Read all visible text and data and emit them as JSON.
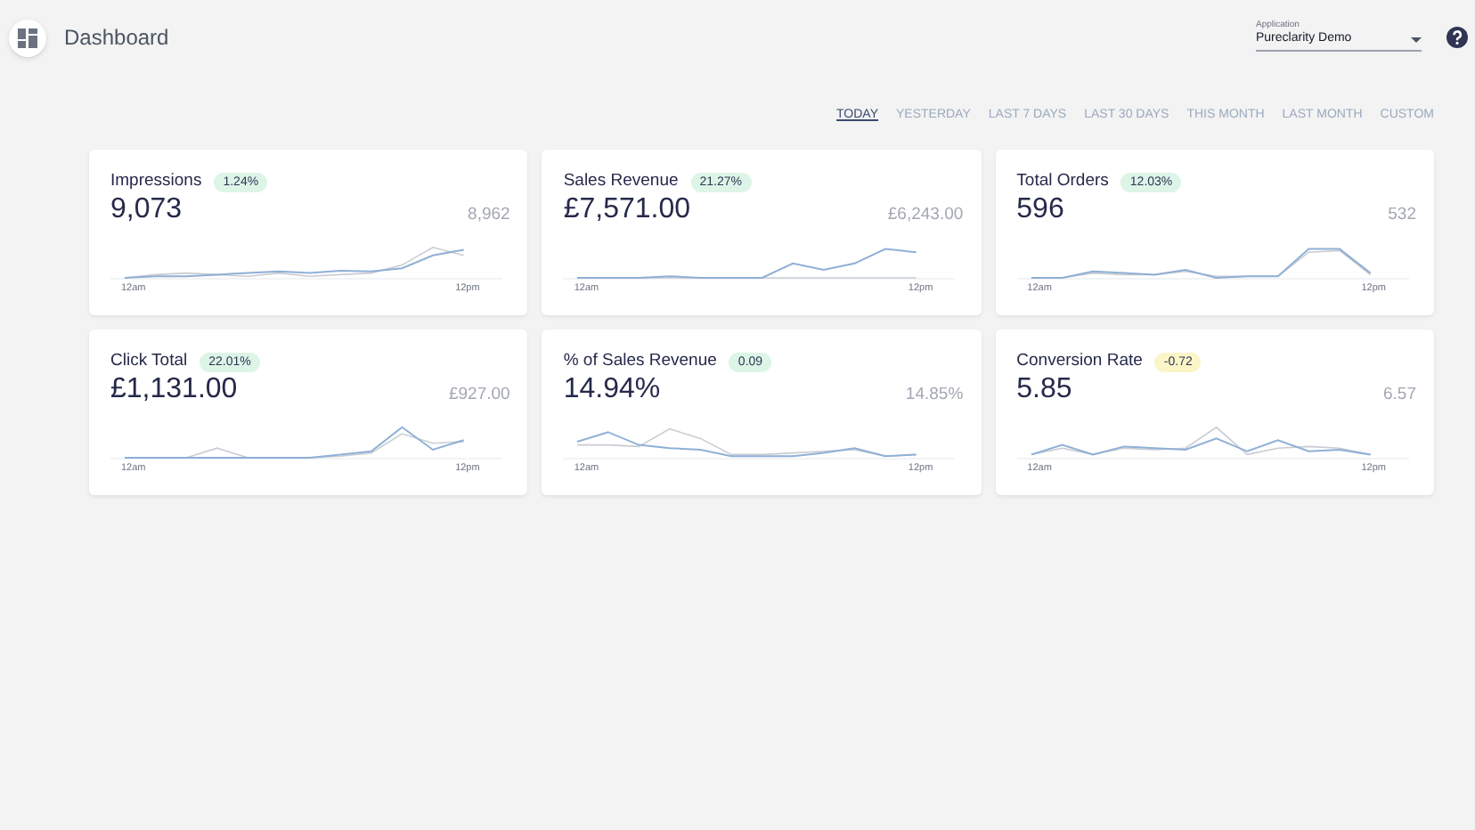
{
  "header": {
    "title": "Dashboard"
  },
  "application": {
    "label": "Application",
    "value": "Pureclarity Demo"
  },
  "date_ranges": [
    {
      "label": "TODAY",
      "selected": true
    },
    {
      "label": "YESTERDAY",
      "selected": false
    },
    {
      "label": "LAST 7 DAYS",
      "selected": false
    },
    {
      "label": "LAST 30 DAYS",
      "selected": false
    },
    {
      "label": "THIS MONTH",
      "selected": false
    },
    {
      "label": "LAST MONTH",
      "selected": false
    },
    {
      "label": "CUSTOM",
      "selected": false
    }
  ],
  "cards": [
    {
      "title": "Impressions",
      "change": "1.24%",
      "color": "#dcf5e7",
      "value": "9,073",
      "previous": "8,962",
      "x_start": "12am",
      "x_end": "12pm"
    },
    {
      "title": "Sales Revenue",
      "change": "21.27%",
      "color": "#dcf5e7",
      "value": "£7,571.00",
      "previous": "£6,243.00",
      "x_start": "12am",
      "x_end": "12pm"
    },
    {
      "title": "Total Orders",
      "change": "12.03%",
      "color": "#dcf5e7",
      "value": "596",
      "previous": "532",
      "x_start": "12am",
      "x_end": "12pm"
    },
    {
      "title": "Click Total",
      "change": "22.01%",
      "color": "#dcf5e7",
      "value": "£1,131.00",
      "previous": "£927.00",
      "x_start": "12am",
      "x_end": "12pm"
    },
    {
      "title": "% of Sales Revenue",
      "change": "0.09",
      "color": "#dcf5e7",
      "value": "14.94%",
      "previous": "14.85%",
      "x_start": "12am",
      "x_end": "12pm"
    },
    {
      "title": "Conversion Rate",
      "change": "-0.72",
      "color": "#fbf5c8",
      "value": "5.85",
      "previous": "6.57",
      "x_start": "12am",
      "x_end": "12pm"
    }
  ]
}
